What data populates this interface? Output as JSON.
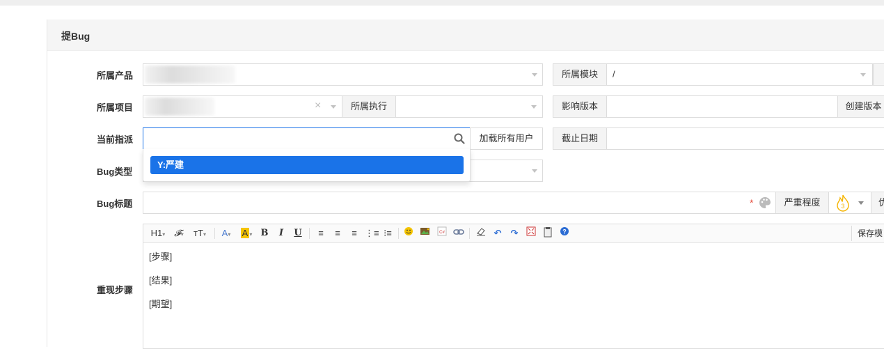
{
  "panel": {
    "title": "提Bug"
  },
  "form": {
    "product_label": "所属产品",
    "module_label": "所属模块",
    "module_value": "/",
    "project_label": "所属项目",
    "execution_label": "所属执行",
    "version_label": "影响版本",
    "create_version_button": "创建版本",
    "assign_label": "当前指派",
    "load_all_users_button": "加载所有用户",
    "deadline_label": "截止日期",
    "bug_type_label": "Bug类型",
    "bug_title_label": "Bug标题",
    "required_mark": "*",
    "severity_label": "严重程度",
    "severity_value": "3",
    "priority_label_partial": "优",
    "steps_label": "重现步骤"
  },
  "assign_dropdown": {
    "options": [
      "Y:严建"
    ]
  },
  "editor": {
    "toolbar": {
      "heading": "H1",
      "font_family": "𝓕",
      "font_size": "тT",
      "save_template": "保存模"
    },
    "lines": [
      "[步骤]",
      "[结果]",
      "[期望]"
    ]
  },
  "colors": {
    "accent": "#1a73e8",
    "required": "#e74c3c",
    "severity": "#f5b400"
  }
}
